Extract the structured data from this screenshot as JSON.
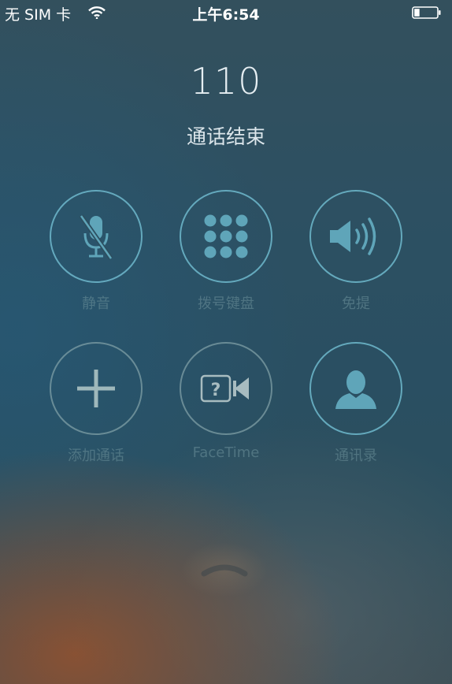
{
  "status_bar": {
    "carrier": "无 SIM 卡",
    "time": "上午6:54",
    "icons": [
      "wifi-icon",
      "battery-icon"
    ]
  },
  "call": {
    "number": "110",
    "status": "通话结束"
  },
  "buttons": [
    {
      "label": "静音",
      "icon": "microphone-muted-icon"
    },
    {
      "label": "拨号键盘",
      "icon": "keypad-icon"
    },
    {
      "label": "免提",
      "icon": "speaker-icon"
    },
    {
      "label": "添加通话",
      "icon": "plus-icon"
    },
    {
      "label": "FaceTime",
      "icon": "facetime-icon"
    },
    {
      "label": "通讯录",
      "icon": "contact-icon"
    }
  ],
  "end_call": {
    "icon": "end-call-icon"
  },
  "colors": {
    "ring": "#6EB9CD",
    "icon_fill": "#5FA5B9",
    "label": "#6E919B"
  }
}
